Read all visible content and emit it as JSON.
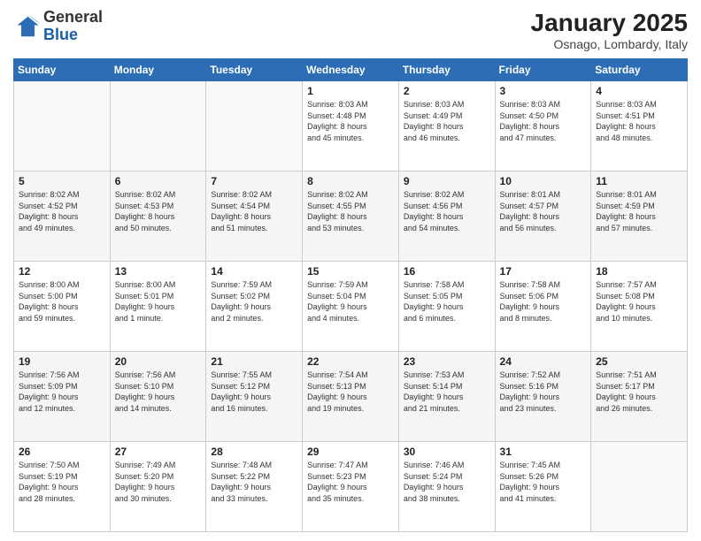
{
  "logo": {
    "general": "General",
    "blue": "Blue"
  },
  "header": {
    "title": "January 2025",
    "subtitle": "Osnago, Lombardy, Italy"
  },
  "weekdays": [
    "Sunday",
    "Monday",
    "Tuesday",
    "Wednesday",
    "Thursday",
    "Friday",
    "Saturday"
  ],
  "weeks": [
    [
      {
        "day": "",
        "info": ""
      },
      {
        "day": "",
        "info": ""
      },
      {
        "day": "",
        "info": ""
      },
      {
        "day": "1",
        "info": "Sunrise: 8:03 AM\nSunset: 4:48 PM\nDaylight: 8 hours\nand 45 minutes."
      },
      {
        "day": "2",
        "info": "Sunrise: 8:03 AM\nSunset: 4:49 PM\nDaylight: 8 hours\nand 46 minutes."
      },
      {
        "day": "3",
        "info": "Sunrise: 8:03 AM\nSunset: 4:50 PM\nDaylight: 8 hours\nand 47 minutes."
      },
      {
        "day": "4",
        "info": "Sunrise: 8:03 AM\nSunset: 4:51 PM\nDaylight: 8 hours\nand 48 minutes."
      }
    ],
    [
      {
        "day": "5",
        "info": "Sunrise: 8:02 AM\nSunset: 4:52 PM\nDaylight: 8 hours\nand 49 minutes."
      },
      {
        "day": "6",
        "info": "Sunrise: 8:02 AM\nSunset: 4:53 PM\nDaylight: 8 hours\nand 50 minutes."
      },
      {
        "day": "7",
        "info": "Sunrise: 8:02 AM\nSunset: 4:54 PM\nDaylight: 8 hours\nand 51 minutes."
      },
      {
        "day": "8",
        "info": "Sunrise: 8:02 AM\nSunset: 4:55 PM\nDaylight: 8 hours\nand 53 minutes."
      },
      {
        "day": "9",
        "info": "Sunrise: 8:02 AM\nSunset: 4:56 PM\nDaylight: 8 hours\nand 54 minutes."
      },
      {
        "day": "10",
        "info": "Sunrise: 8:01 AM\nSunset: 4:57 PM\nDaylight: 8 hours\nand 56 minutes."
      },
      {
        "day": "11",
        "info": "Sunrise: 8:01 AM\nSunset: 4:59 PM\nDaylight: 8 hours\nand 57 minutes."
      }
    ],
    [
      {
        "day": "12",
        "info": "Sunrise: 8:00 AM\nSunset: 5:00 PM\nDaylight: 8 hours\nand 59 minutes."
      },
      {
        "day": "13",
        "info": "Sunrise: 8:00 AM\nSunset: 5:01 PM\nDaylight: 9 hours\nand 1 minute."
      },
      {
        "day": "14",
        "info": "Sunrise: 7:59 AM\nSunset: 5:02 PM\nDaylight: 9 hours\nand 2 minutes."
      },
      {
        "day": "15",
        "info": "Sunrise: 7:59 AM\nSunset: 5:04 PM\nDaylight: 9 hours\nand 4 minutes."
      },
      {
        "day": "16",
        "info": "Sunrise: 7:58 AM\nSunset: 5:05 PM\nDaylight: 9 hours\nand 6 minutes."
      },
      {
        "day": "17",
        "info": "Sunrise: 7:58 AM\nSunset: 5:06 PM\nDaylight: 9 hours\nand 8 minutes."
      },
      {
        "day": "18",
        "info": "Sunrise: 7:57 AM\nSunset: 5:08 PM\nDaylight: 9 hours\nand 10 minutes."
      }
    ],
    [
      {
        "day": "19",
        "info": "Sunrise: 7:56 AM\nSunset: 5:09 PM\nDaylight: 9 hours\nand 12 minutes."
      },
      {
        "day": "20",
        "info": "Sunrise: 7:56 AM\nSunset: 5:10 PM\nDaylight: 9 hours\nand 14 minutes."
      },
      {
        "day": "21",
        "info": "Sunrise: 7:55 AM\nSunset: 5:12 PM\nDaylight: 9 hours\nand 16 minutes."
      },
      {
        "day": "22",
        "info": "Sunrise: 7:54 AM\nSunset: 5:13 PM\nDaylight: 9 hours\nand 19 minutes."
      },
      {
        "day": "23",
        "info": "Sunrise: 7:53 AM\nSunset: 5:14 PM\nDaylight: 9 hours\nand 21 minutes."
      },
      {
        "day": "24",
        "info": "Sunrise: 7:52 AM\nSunset: 5:16 PM\nDaylight: 9 hours\nand 23 minutes."
      },
      {
        "day": "25",
        "info": "Sunrise: 7:51 AM\nSunset: 5:17 PM\nDaylight: 9 hours\nand 26 minutes."
      }
    ],
    [
      {
        "day": "26",
        "info": "Sunrise: 7:50 AM\nSunset: 5:19 PM\nDaylight: 9 hours\nand 28 minutes."
      },
      {
        "day": "27",
        "info": "Sunrise: 7:49 AM\nSunset: 5:20 PM\nDaylight: 9 hours\nand 30 minutes."
      },
      {
        "day": "28",
        "info": "Sunrise: 7:48 AM\nSunset: 5:22 PM\nDaylight: 9 hours\nand 33 minutes."
      },
      {
        "day": "29",
        "info": "Sunrise: 7:47 AM\nSunset: 5:23 PM\nDaylight: 9 hours\nand 35 minutes."
      },
      {
        "day": "30",
        "info": "Sunrise: 7:46 AM\nSunset: 5:24 PM\nDaylight: 9 hours\nand 38 minutes."
      },
      {
        "day": "31",
        "info": "Sunrise: 7:45 AM\nSunset: 5:26 PM\nDaylight: 9 hours\nand 41 minutes."
      },
      {
        "day": "",
        "info": ""
      }
    ]
  ]
}
